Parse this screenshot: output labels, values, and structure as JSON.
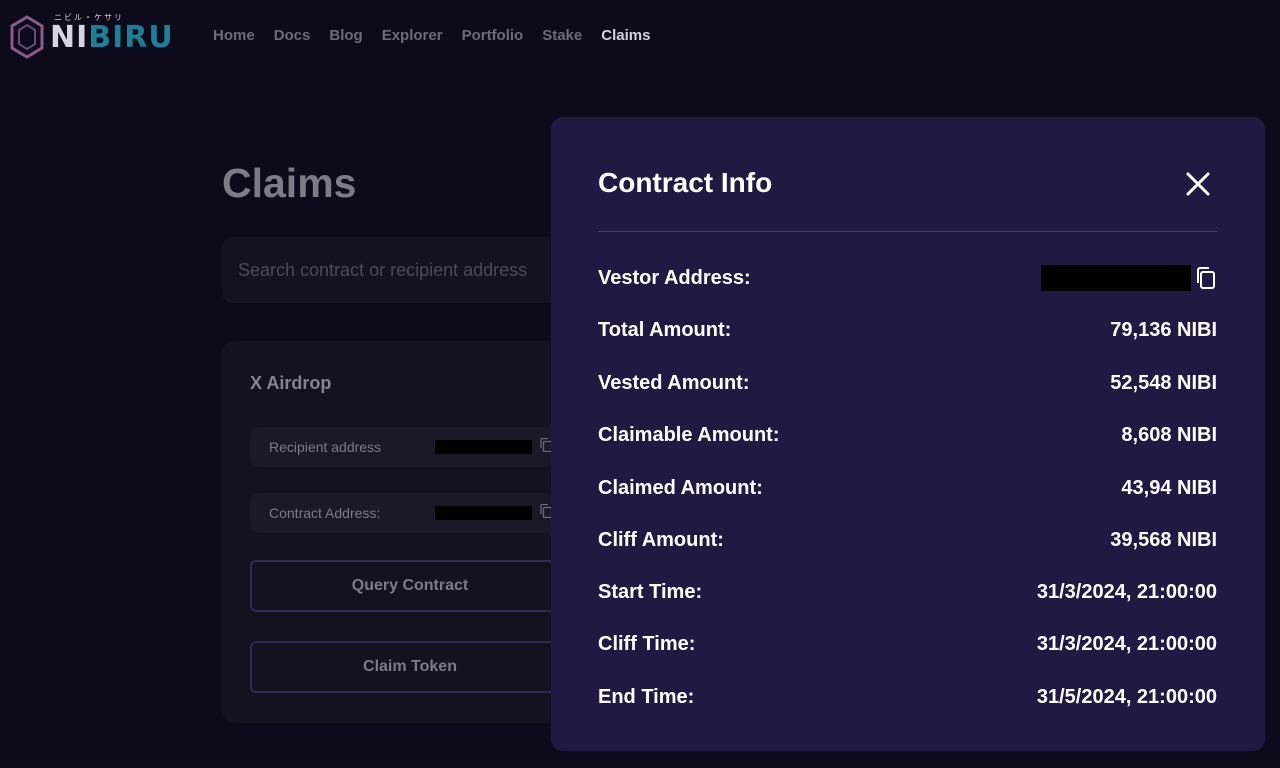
{
  "header": {
    "logo_text_ni": "NI",
    "logo_text_rest": "BIRU",
    "logo_subtext": "ニビル・ケサリ",
    "nav": [
      {
        "label": "Home"
      },
      {
        "label": "Docs"
      },
      {
        "label": "Blog"
      },
      {
        "label": "Explorer"
      },
      {
        "label": "Portfolio"
      },
      {
        "label": "Stake"
      },
      {
        "label": "Claims",
        "active": true
      }
    ]
  },
  "page": {
    "title": "Claims",
    "search_placeholder": "Search contract or recipient address"
  },
  "card": {
    "title": "X Airdrop",
    "recipient_label": "Recipient address",
    "contract_label": "Contract Address:",
    "query_button": "Query Contract",
    "claim_button": "Claim Token"
  },
  "modal": {
    "title": "Contract Info",
    "rows": [
      {
        "label": "Vestor Address:",
        "value": ""
      },
      {
        "label": "Total Amount:",
        "value": "79,136 NIBI"
      },
      {
        "label": "Vested Amount:",
        "value": "52,548 NIBI"
      },
      {
        "label": "Claimable Amount:",
        "value": "8,608 NIBI"
      },
      {
        "label": "Claimed Amount:",
        "value": "43,94 NIBI"
      },
      {
        "label": "Cliff Amount:",
        "value": "39,568 NIBI"
      },
      {
        "label": "Start Time:",
        "value": "31/3/2024, 21:00:00"
      },
      {
        "label": "Cliff Time:",
        "value": "31/3/2024, 21:00:00"
      },
      {
        "label": "End Time:",
        "value": "31/5/2024, 21:00:00"
      }
    ]
  },
  "colors": {
    "background": "#0d0a1b",
    "modal_bg": "#201a43",
    "brand_teal": "#1d7f95",
    "button_border": "#34285a"
  }
}
